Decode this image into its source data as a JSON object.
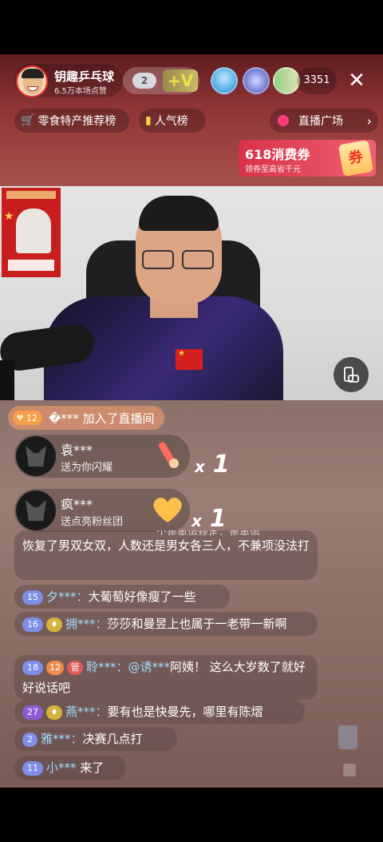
{
  "header": {
    "host_name": "钥趣乒乓球",
    "host_likes": "6.5万本场点赞",
    "badge_level": "2",
    "badge_vip": "+V",
    "viewer_count": "3351",
    "close_symbol": "✕"
  },
  "rank": {
    "snack_label": "零食特产推荐榜",
    "popularity_label": "人气榜",
    "plaza_label": "直播广场",
    "plaza_chevron": "›"
  },
  "coupon": {
    "title": "618消费券",
    "subtitle": "领券至高省千元",
    "tag": "券"
  },
  "join": {
    "level": "12",
    "text": "�*** 加入了直播间"
  },
  "gifts": [
    {
      "name": "袁***",
      "desc": "送为你闪耀",
      "count_x": "x",
      "count_n": "1"
    },
    {
      "name": "疯***",
      "desc": "送点亮粉丝团",
      "count_x": "x",
      "count_n": "1"
    }
  ],
  "messages": [
    {
      "text_partial": "个是奥运规定，是奥运",
      "text": "恢复了男双女双，人数还是男女各三人，不兼项没法打"
    },
    {
      "level": "15",
      "user": "夕***：",
      "text": "大葡萄好像瘦了一些"
    },
    {
      "level": "16",
      "user": "拥***：",
      "text": "莎莎和曼昱上也属于一老带一新啊"
    },
    {
      "level": "18",
      "badge1": "12",
      "badge2": "管",
      "user": "聆***：",
      "mention": "@诱***",
      "text": "阿姨！ 这么大岁数了就好好说话吧"
    },
    {
      "level": "27",
      "user": "燕***：",
      "text": "要有也是快曼先，哪里有陈熠"
    },
    {
      "level": "2",
      "user": "雅***：",
      "text": "决赛几点打"
    },
    {
      "level": "11",
      "user": "小***",
      "text": "来了"
    }
  ],
  "colors": {
    "username": "#9fdcff",
    "join_bg": "#f6a04a",
    "coupon": "#d8324a"
  }
}
